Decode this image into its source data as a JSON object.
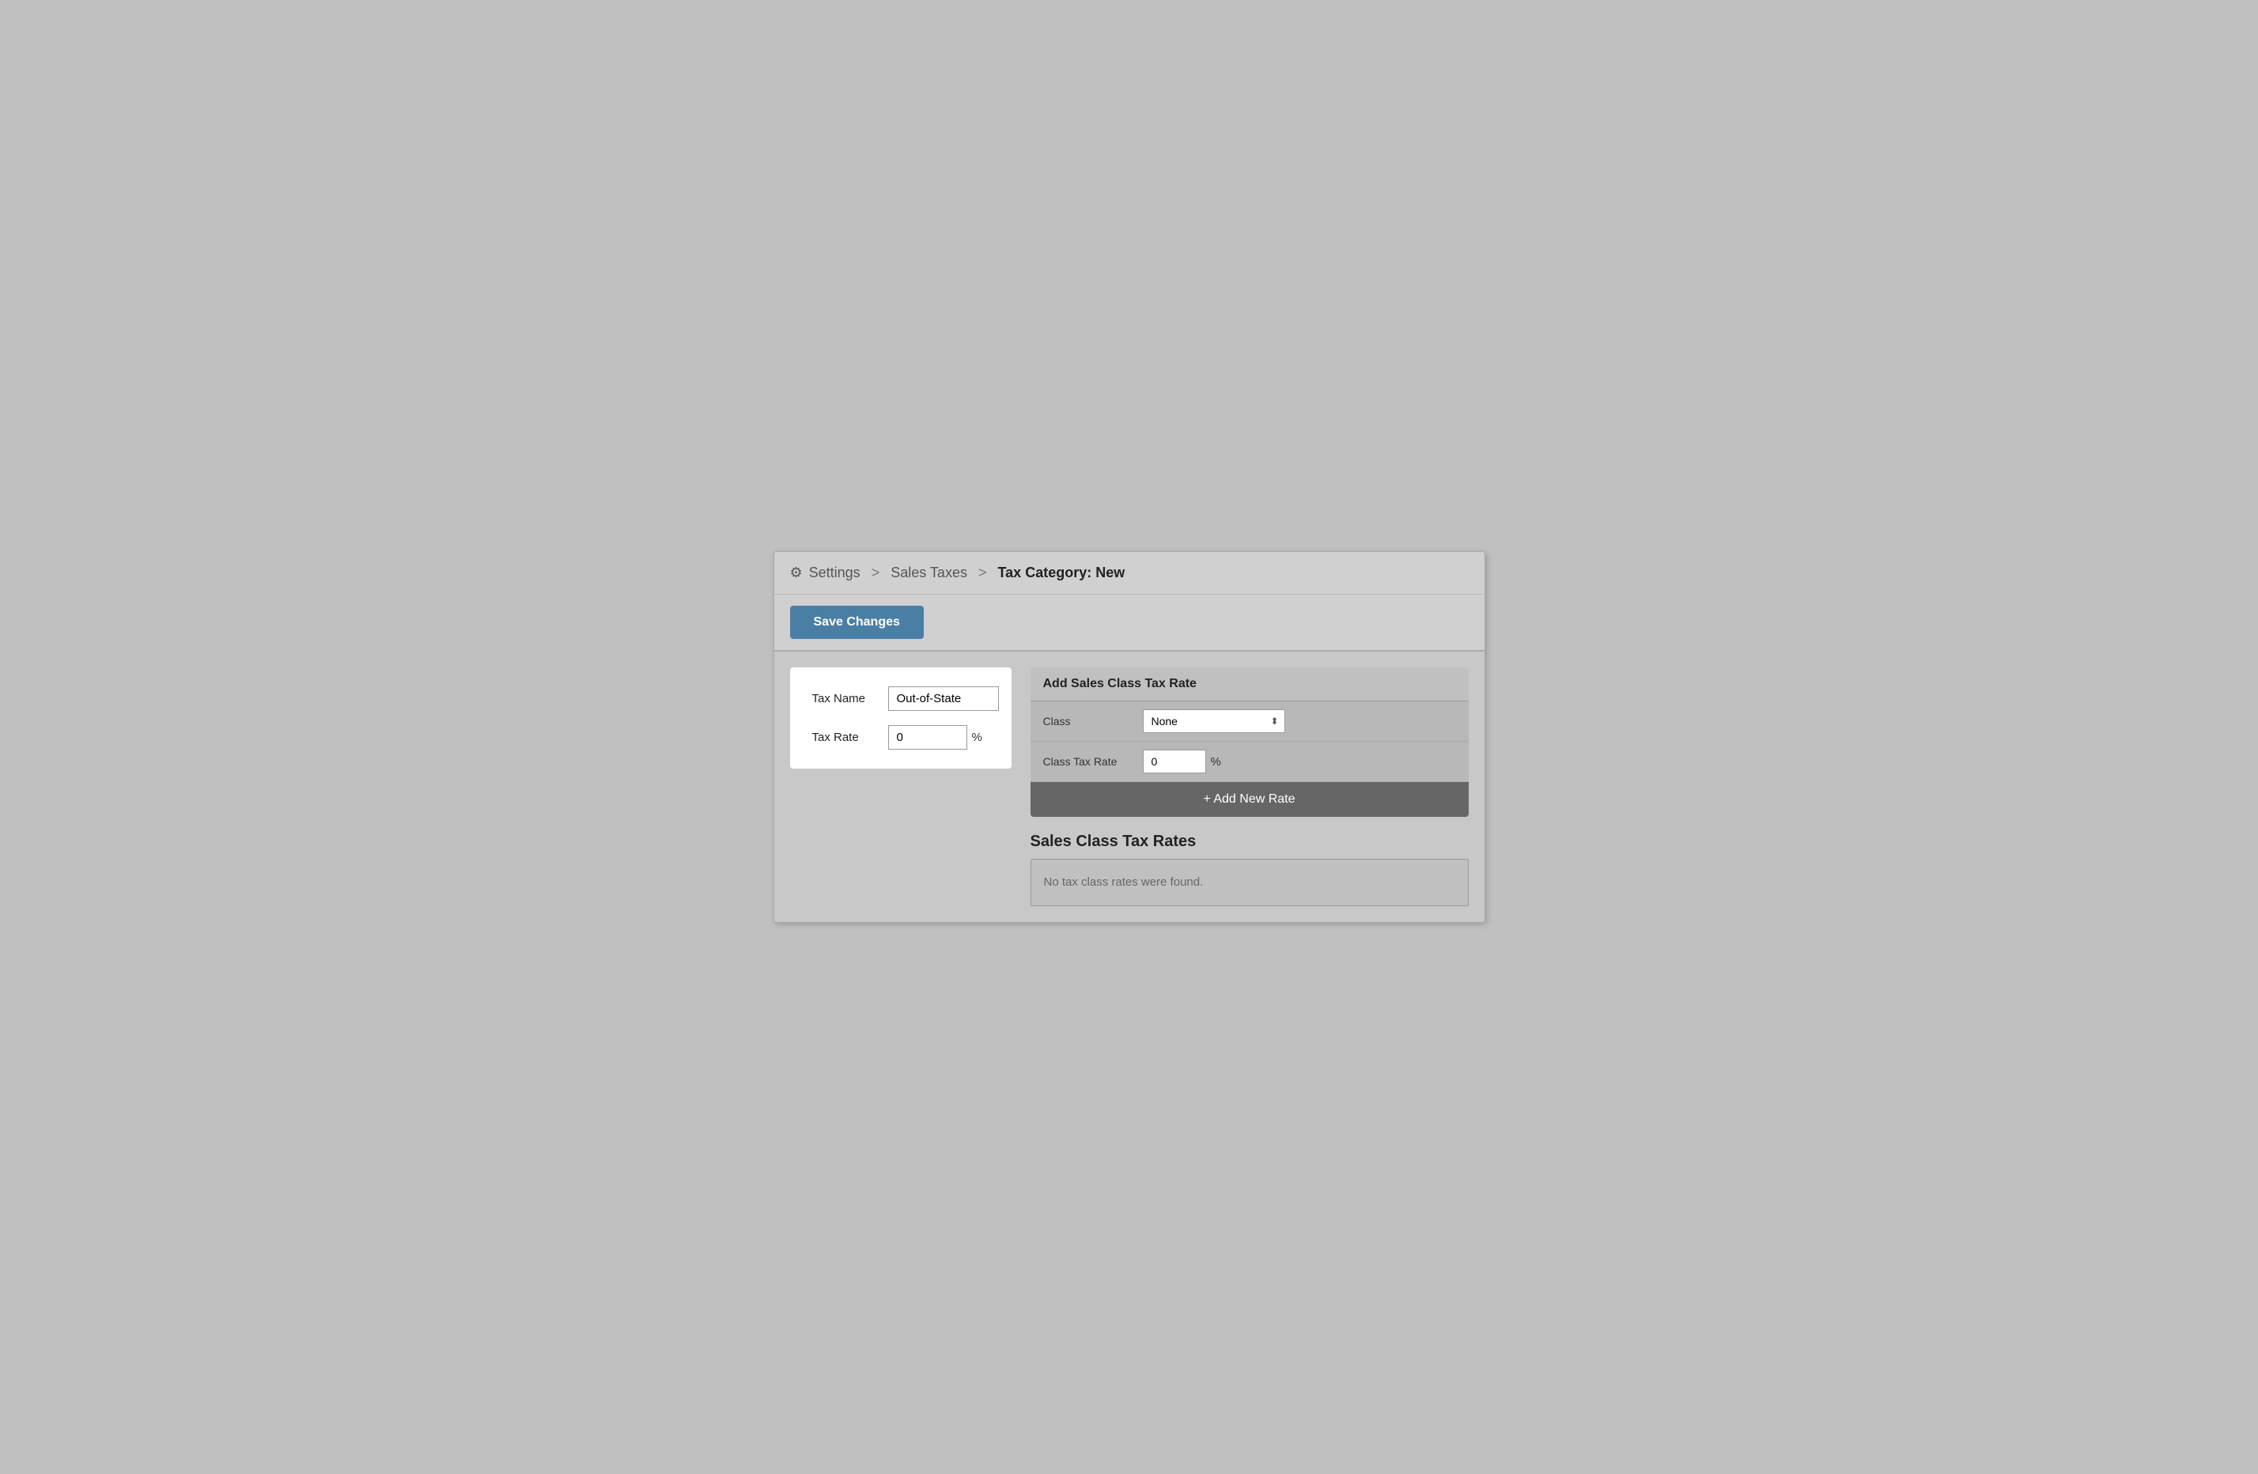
{
  "breadcrumb": {
    "icon": "⚙",
    "parts": [
      "Settings",
      "Sales Taxes",
      "Tax Category: New"
    ],
    "separator": ">"
  },
  "toolbar": {
    "save_button_label": "Save Changes"
  },
  "left_panel": {
    "tax_name_label": "Tax Name",
    "tax_name_value": "Out-of-State",
    "tax_rate_label": "Tax Rate",
    "tax_rate_value": "0",
    "tax_rate_suffix": "%"
  },
  "right_panel": {
    "add_section_title": "Add Sales Class Tax Rate",
    "class_label": "Class",
    "class_select_value": "None",
    "class_options": [
      "None"
    ],
    "class_tax_rate_label": "Class Tax Rate",
    "class_tax_rate_value": "0",
    "class_tax_rate_suffix": "%",
    "add_button_label": "+ Add New Rate",
    "sales_class_title": "Sales Class Tax Rates",
    "empty_message": "No tax class rates were found."
  }
}
